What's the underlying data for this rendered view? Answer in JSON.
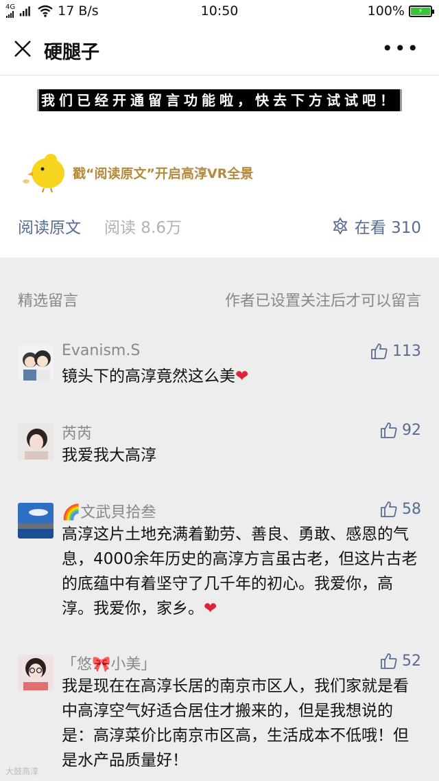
{
  "status_bar": {
    "network": "4G",
    "speed": "17 B/s",
    "time": "10:50",
    "battery": "100%"
  },
  "nav": {
    "title": "硬腿子"
  },
  "article": {
    "notice": "我们已经开通留言功能啦，快去下方试试吧！",
    "promo": "戳“阅读原文”开启高淳VR全景",
    "read_original": "阅读原文",
    "read_count": "阅读 8.6万",
    "watching": "在看 310"
  },
  "comments": {
    "header_left": "精选留言",
    "header_right": "作者已设置关注后才可以留言",
    "items": [
      {
        "name": "Evanism.S",
        "likes": "113",
        "text": "镜头下的高淳竟然这么美",
        "heart": "❤"
      },
      {
        "name": "芮芮",
        "likes": "92",
        "text": "我爱我大高淳",
        "heart": ""
      },
      {
        "name": "🌈文武貝拾叁",
        "likes": "58",
        "text": "高淳这片土地充满着勤劳、善良、勇敢、感恩的气息，4000余年历史的高淳方言虽古老，但这片古老的底蕴中有着坚守了几千年的初心。我爱你，高淳。我爱你，家乡。",
        "heart": "❤"
      },
      {
        "name": "「悠🎀小美」",
        "likes": "52",
        "text": "我是现在在高淳长居的南京市区人，我们家就是看中高淳空气好适合居住才搬来的，但是我想说的是：高淳菜价比南京市区高，生活成本不低哦！但是水产品质量好！",
        "heart": ""
      }
    ]
  },
  "watermark": "大鼓高淳",
  "colors": {
    "link": "#576b95",
    "promo": "#b58a3c",
    "battery": "#38c338"
  }
}
